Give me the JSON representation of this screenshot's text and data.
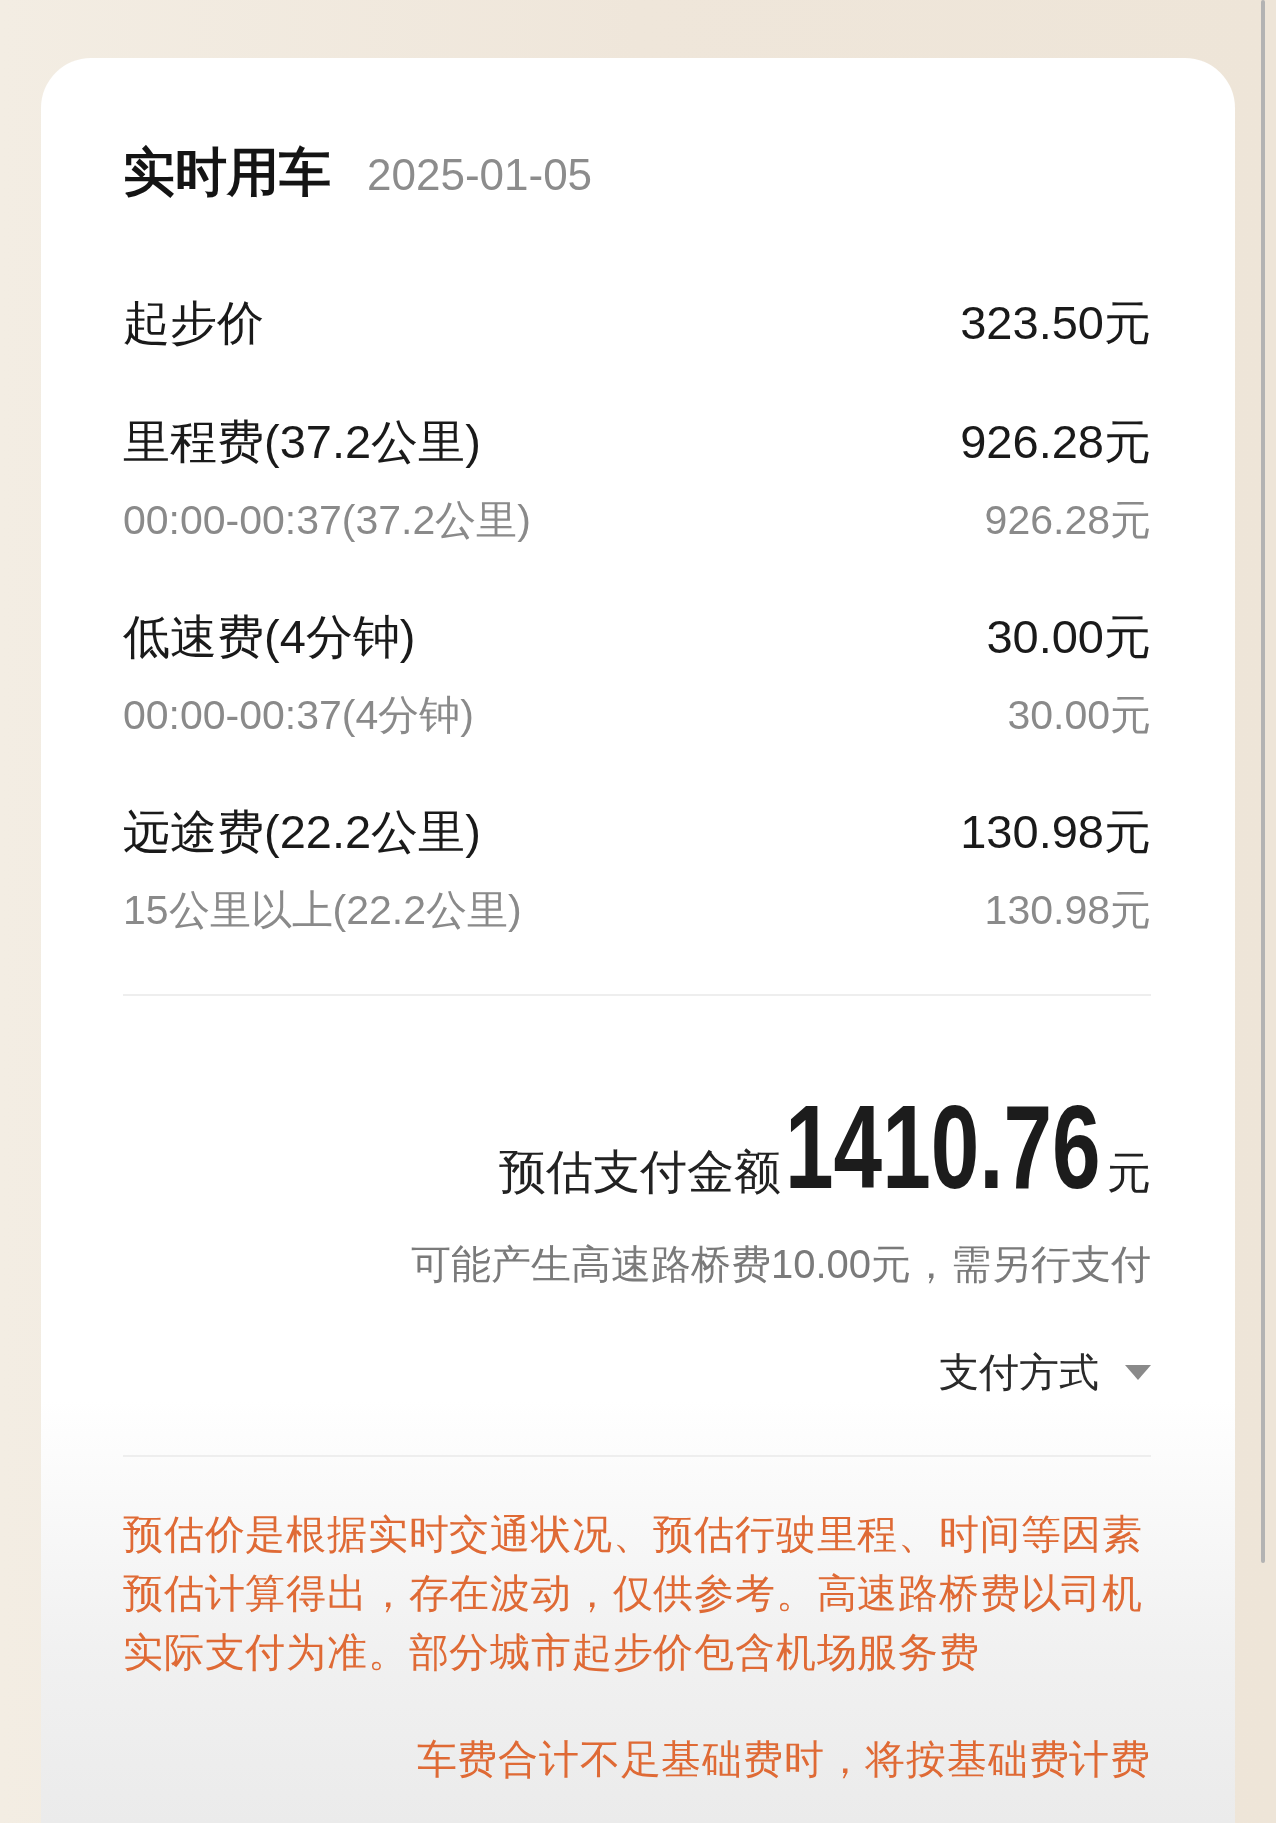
{
  "card": {
    "title": "实时用车",
    "date": "2025-01-05"
  },
  "fees": [
    {
      "label": "起步价",
      "amount": "323.50元"
    },
    {
      "label": "里程费(37.2公里)",
      "amount": "926.28元",
      "details": [
        {
          "label": "00:00-00:37(37.2公里)",
          "amount": "926.28元"
        }
      ]
    },
    {
      "label": "低速费(4分钟)",
      "amount": "30.00元",
      "details": [
        {
          "label": "00:00-00:37(4分钟)",
          "amount": "30.00元"
        }
      ]
    },
    {
      "label": "远途费(22.2公里)",
      "amount": "130.98元",
      "details": [
        {
          "label": "15公里以上(22.2公里)",
          "amount": "130.98元"
        }
      ]
    }
  ],
  "total": {
    "label": "预估支付金额",
    "amount": "1410.76",
    "unit": "元",
    "note": "可能产生高速路桥费10.00元，需另行支付"
  },
  "payment_method": {
    "label": "支付方式",
    "expanded": false
  },
  "disclaimer": "预估价是根据实时交通状况、预估行驶里程、时间等因素预估计算得出，存在波动，仅供参考。高速路桥费以司机实际支付为准。部分城市起步价包含机场服务费",
  "minimum_fare_note": "车费合计不足基础费时，将按基础费计费"
}
